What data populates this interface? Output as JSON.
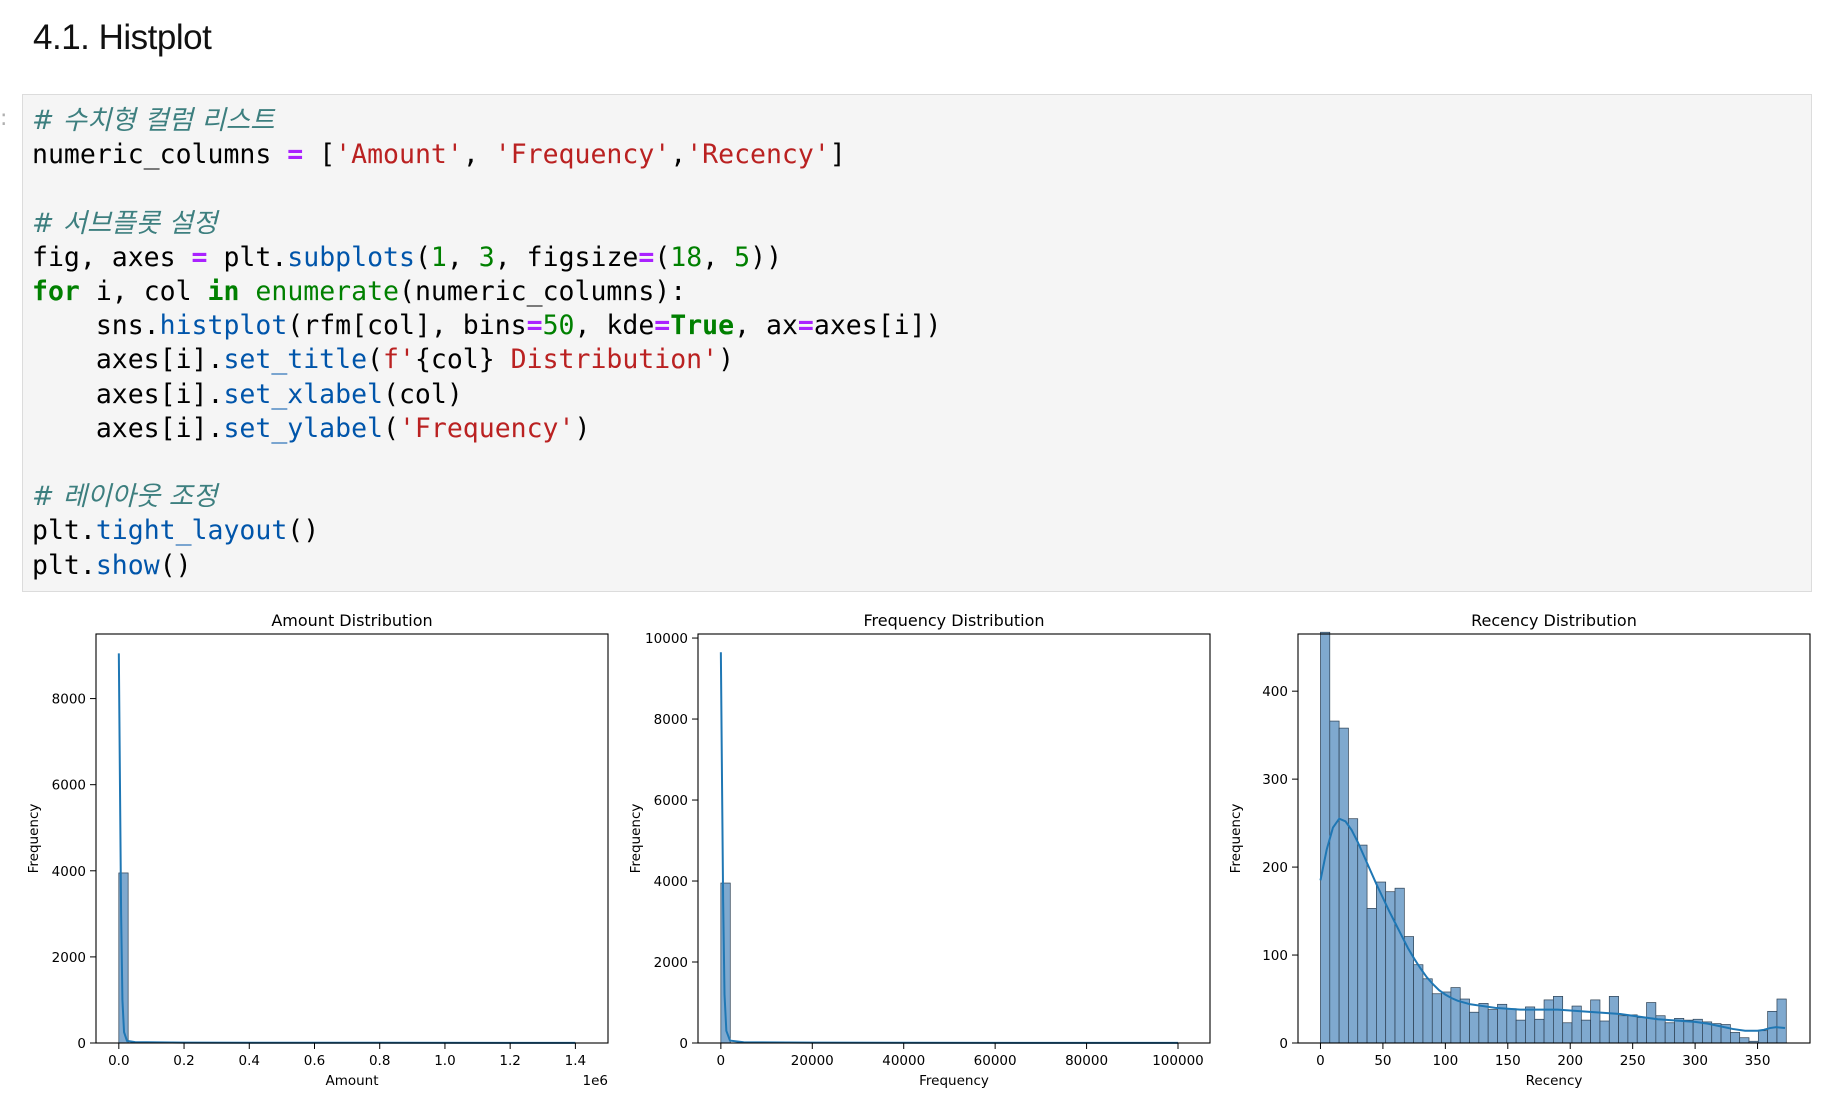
{
  "heading": "4.1. Histplot",
  "code_lines": [
    [
      {
        "t": "# 수치형 컬럼 리스트",
        "c": "cm"
      }
    ],
    [
      {
        "t": "numeric_columns ",
        "c": ""
      },
      {
        "t": "=",
        "c": "op"
      },
      {
        "t": " [",
        "c": ""
      },
      {
        "t": "'Amount'",
        "c": "s"
      },
      {
        "t": ", ",
        "c": ""
      },
      {
        "t": "'Frequency'",
        "c": "s"
      },
      {
        "t": ",",
        "c": ""
      },
      {
        "t": "'Recency'",
        "c": "s"
      },
      {
        "t": "]",
        "c": ""
      }
    ],
    [],
    [
      {
        "t": "# 서브플롯 설정",
        "c": "cm"
      }
    ],
    [
      {
        "t": "fig, axes ",
        "c": ""
      },
      {
        "t": "=",
        "c": "op"
      },
      {
        "t": " plt.",
        "c": ""
      },
      {
        "t": "subplots",
        "c": "fn"
      },
      {
        "t": "(",
        "c": ""
      },
      {
        "t": "1",
        "c": "n"
      },
      {
        "t": ", ",
        "c": ""
      },
      {
        "t": "3",
        "c": "n"
      },
      {
        "t": ", figsize",
        "c": ""
      },
      {
        "t": "=",
        "c": "op"
      },
      {
        "t": "(",
        "c": ""
      },
      {
        "t": "18",
        "c": "n"
      },
      {
        "t": ", ",
        "c": ""
      },
      {
        "t": "5",
        "c": "n"
      },
      {
        "t": "))",
        "c": ""
      }
    ],
    [
      {
        "t": "for",
        "c": "kw"
      },
      {
        "t": " i, col ",
        "c": ""
      },
      {
        "t": "in",
        "c": "kw"
      },
      {
        "t": " ",
        "c": ""
      },
      {
        "t": "enumerate",
        "c": "bi"
      },
      {
        "t": "(numeric_columns):",
        "c": ""
      }
    ],
    [
      {
        "t": "    sns.",
        "c": ""
      },
      {
        "t": "histplot",
        "c": "fn"
      },
      {
        "t": "(rfm[col], bins",
        "c": ""
      },
      {
        "t": "=",
        "c": "op"
      },
      {
        "t": "50",
        "c": "n"
      },
      {
        "t": ", kde",
        "c": ""
      },
      {
        "t": "=",
        "c": "op"
      },
      {
        "t": "True",
        "c": "kw"
      },
      {
        "t": ", ax",
        "c": ""
      },
      {
        "t": "=",
        "c": "op"
      },
      {
        "t": "axes[i])",
        "c": ""
      }
    ],
    [
      {
        "t": "    axes[i].",
        "c": ""
      },
      {
        "t": "set_title",
        "c": "fn"
      },
      {
        "t": "(",
        "c": ""
      },
      {
        "t": "f'",
        "c": "s"
      },
      {
        "t": "{col}",
        "c": ""
      },
      {
        "t": " Distribution'",
        "c": "s"
      },
      {
        "t": ")",
        "c": ""
      }
    ],
    [
      {
        "t": "    axes[i].",
        "c": ""
      },
      {
        "t": "set_xlabel",
        "c": "fn"
      },
      {
        "t": "(col)",
        "c": ""
      }
    ],
    [
      {
        "t": "    axes[i].",
        "c": ""
      },
      {
        "t": "set_ylabel",
        "c": "fn"
      },
      {
        "t": "(",
        "c": ""
      },
      {
        "t": "'Frequency'",
        "c": "s"
      },
      {
        "t": ")",
        "c": ""
      }
    ],
    [],
    [
      {
        "t": "# 레이아웃 조정",
        "c": "cm"
      }
    ],
    [
      {
        "t": "plt.",
        "c": ""
      },
      {
        "t": "tight_layout",
        "c": "fn"
      },
      {
        "t": "()",
        "c": ""
      }
    ],
    [
      {
        "t": "plt.",
        "c": ""
      },
      {
        "t": "show",
        "c": "fn"
      },
      {
        "t": "()",
        "c": ""
      }
    ]
  ],
  "colors": {
    "bar_fill": "#7fa9cf",
    "bar_edge": "#2b3f52",
    "kde_line": "#1f77b4"
  },
  "chart_data": [
    {
      "type": "bar",
      "title": "Amount Distribution",
      "xlabel": "Amount",
      "ylabel": "Frequency",
      "offset_text": "1e6",
      "xlim": [
        -0.07,
        1.5
      ],
      "ylim": [
        0,
        9500
      ],
      "xticks": [
        0.0,
        0.2,
        0.4,
        0.6,
        0.8,
        1.0,
        1.2,
        1.4
      ],
      "xtick_labels": [
        "0.0",
        "0.2",
        "0.4",
        "0.6",
        "0.8",
        "1.0",
        "1.2",
        "1.4"
      ],
      "yticks": [
        0,
        2000,
        4000,
        6000,
        8000
      ],
      "ytick_labels": [
        "0",
        "2000",
        "4000",
        "6000",
        "8000"
      ],
      "bin_width": 0.0286,
      "bins": [
        [
          0.0,
          3950
        ]
      ],
      "kde": [
        [
          0.0,
          9050
        ],
        [
          0.0035,
          6000
        ],
        [
          0.007,
          3000
        ],
        [
          0.011,
          1000
        ],
        [
          0.016,
          250
        ],
        [
          0.025,
          50
        ],
        [
          0.05,
          20
        ],
        [
          0.2,
          8
        ],
        [
          1.4,
          2
        ]
      ]
    },
    {
      "type": "bar",
      "title": "Frequency Distribution",
      "xlabel": "Frequency",
      "ylabel": "Frequency",
      "xlim": [
        -5000,
        107000
      ],
      "ylim": [
        0,
        10100
      ],
      "xticks": [
        0,
        20000,
        40000,
        60000,
        80000,
        100000
      ],
      "xtick_labels": [
        "0",
        "20000",
        "40000",
        "60000",
        "80000",
        "100000"
      ],
      "yticks": [
        0,
        2000,
        4000,
        6000,
        8000,
        10000
      ],
      "ytick_labels": [
        "0",
        "2000",
        "4000",
        "6000",
        "8000",
        "10000"
      ],
      "bin_width": 2060,
      "bins": [
        [
          0,
          3950
        ]
      ],
      "kde": [
        [
          0,
          9650
        ],
        [
          250,
          6500
        ],
        [
          500,
          3500
        ],
        [
          800,
          1200
        ],
        [
          1200,
          300
        ],
        [
          2000,
          60
        ],
        [
          5000,
          20
        ],
        [
          20000,
          8
        ],
        [
          100000,
          2
        ]
      ]
    },
    {
      "type": "bar",
      "title": "Recency Distribution",
      "xlabel": "Recency",
      "ylabel": "Frequency",
      "xlim": [
        -18,
        392
      ],
      "ylim": [
        0,
        465
      ],
      "xticks": [
        0,
        50,
        100,
        150,
        200,
        250,
        300,
        350
      ],
      "xtick_labels": [
        "0",
        "50",
        "100",
        "150",
        "200",
        "250",
        "300",
        "350"
      ],
      "yticks": [
        0,
        100,
        200,
        300,
        400
      ],
      "ytick_labels": [
        "0",
        "100",
        "200",
        "300",
        "400"
      ],
      "bin_width": 7.46,
      "bins": [
        [
          0,
          467
        ],
        [
          7.46,
          366
        ],
        [
          14.92,
          358
        ],
        [
          22.38,
          255
        ],
        [
          29.84,
          225
        ],
        [
          37.3,
          153
        ],
        [
          44.76,
          183
        ],
        [
          52.22,
          172
        ],
        [
          59.68,
          176
        ],
        [
          67.14,
          121
        ],
        [
          74.6,
          89
        ],
        [
          82.06,
          73
        ],
        [
          89.52,
          56
        ],
        [
          96.98,
          58
        ],
        [
          104.44,
          63
        ],
        [
          111.9,
          50
        ],
        [
          119.36,
          35
        ],
        [
          126.82,
          45
        ],
        [
          134.28,
          38
        ],
        [
          141.74,
          44
        ],
        [
          149.2,
          39
        ],
        [
          156.66,
          26
        ],
        [
          164.12,
          41
        ],
        [
          171.58,
          27
        ],
        [
          179.04,
          49
        ],
        [
          186.5,
          53
        ],
        [
          193.96,
          23
        ],
        [
          201.42,
          42
        ],
        [
          208.88,
          26
        ],
        [
          216.34,
          49
        ],
        [
          223.8,
          25
        ],
        [
          231.26,
          53
        ],
        [
          238.72,
          31
        ],
        [
          246.18,
          32
        ],
        [
          253.64,
          29
        ],
        [
          261.1,
          46
        ],
        [
          268.56,
          31
        ],
        [
          276.02,
          23
        ],
        [
          283.48,
          28
        ],
        [
          290.94,
          26
        ],
        [
          298.4,
          27
        ],
        [
          305.86,
          24
        ],
        [
          313.32,
          22
        ],
        [
          320.78,
          21
        ],
        [
          328.24,
          12
        ],
        [
          335.7,
          6
        ],
        [
          343.16,
          2
        ],
        [
          350.62,
          14
        ],
        [
          358.08,
          36
        ],
        [
          365.54,
          50
        ]
      ],
      "kde": [
        [
          0,
          185
        ],
        [
          5,
          220
        ],
        [
          10,
          245
        ],
        [
          15,
          255
        ],
        [
          20,
          252
        ],
        [
          25,
          242
        ],
        [
          30,
          228
        ],
        [
          35,
          212
        ],
        [
          40,
          196
        ],
        [
          45,
          180
        ],
        [
          50,
          165
        ],
        [
          55,
          150
        ],
        [
          60,
          136
        ],
        [
          65,
          122
        ],
        [
          70,
          108
        ],
        [
          75,
          96
        ],
        [
          80,
          85
        ],
        [
          85,
          75
        ],
        [
          90,
          67
        ],
        [
          95,
          60
        ],
        [
          100,
          55
        ],
        [
          105,
          51
        ],
        [
          110,
          48
        ],
        [
          120,
          44
        ],
        [
          130,
          42
        ],
        [
          140,
          40
        ],
        [
          150,
          39
        ],
        [
          160,
          38
        ],
        [
          170,
          38
        ],
        [
          180,
          38
        ],
        [
          190,
          38
        ],
        [
          200,
          37
        ],
        [
          210,
          36
        ],
        [
          220,
          35
        ],
        [
          230,
          34
        ],
        [
          240,
          33
        ],
        [
          250,
          31
        ],
        [
          260,
          29
        ],
        [
          270,
          27
        ],
        [
          280,
          26
        ],
        [
          290,
          25
        ],
        [
          300,
          24
        ],
        [
          310,
          22
        ],
        [
          320,
          19
        ],
        [
          330,
          16
        ],
        [
          340,
          14
        ],
        [
          350,
          14
        ],
        [
          355,
          15
        ],
        [
          360,
          17
        ],
        [
          365,
          18
        ],
        [
          372,
          17
        ]
      ]
    }
  ]
}
